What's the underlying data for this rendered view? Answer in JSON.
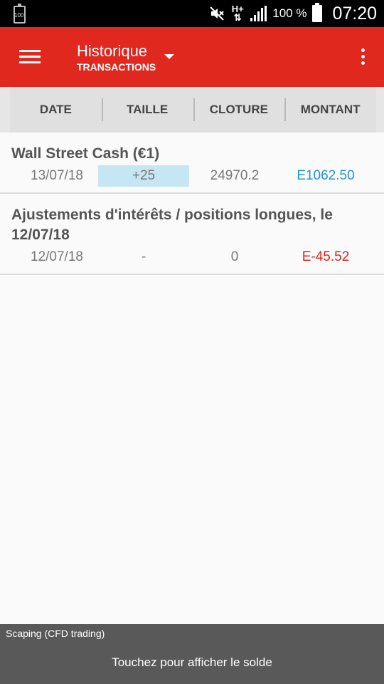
{
  "status_bar": {
    "left_battery_label": "100",
    "battery_percent": "100 %",
    "network": "H+",
    "time": "07:20"
  },
  "app_bar": {
    "title": "Historique",
    "subtitle": "TRANSACTIONS"
  },
  "columns": [
    "DATE",
    "TAILLE",
    "CLOTURE",
    "MONTANT"
  ],
  "transactions": [
    {
      "title": "Wall Street Cash (€1)",
      "date": "13/07/18",
      "size": "+25",
      "close": "24970.2",
      "amount": "E1062.50",
      "amount_color": "#1e96cc"
    },
    {
      "title": "Ajustements d'intérêts / positions longues, le 12/07/18",
      "date": "12/07/18",
      "size": "-",
      "close": "0",
      "amount": "E-45.52",
      "amount_color": "#d9251c"
    }
  ],
  "bottom_bar": {
    "account": "Scaping (CFD trading)",
    "action": "Touchez pour afficher le solde"
  }
}
